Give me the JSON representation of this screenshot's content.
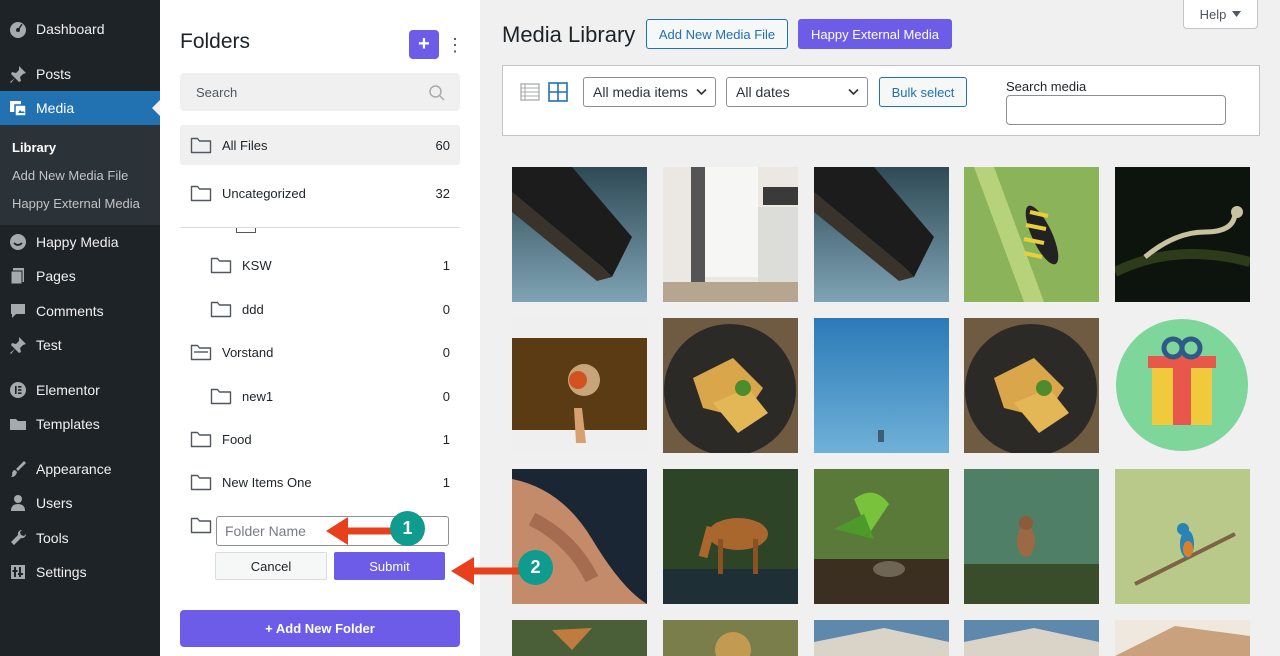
{
  "admin_menu": {
    "items": [
      {
        "label": "Dashboard",
        "icon": "dashboard-icon"
      },
      {
        "label": "Posts",
        "icon": "pin-icon"
      },
      {
        "label": "Media",
        "icon": "media-icon"
      },
      {
        "label": "Happy Media",
        "icon": "happy-media-icon"
      },
      {
        "label": "Pages",
        "icon": "pages-icon"
      },
      {
        "label": "Comments",
        "icon": "comments-icon"
      },
      {
        "label": "Test",
        "icon": "pin-icon"
      },
      {
        "label": "Elementor",
        "icon": "elementor-icon"
      },
      {
        "label": "Templates",
        "icon": "folder-icon"
      },
      {
        "label": "Appearance",
        "icon": "brush-icon"
      },
      {
        "label": "Users",
        "icon": "users-icon"
      },
      {
        "label": "Tools",
        "icon": "wrench-icon"
      },
      {
        "label": "Settings",
        "icon": "settings-icon"
      }
    ],
    "submenu": [
      "Library",
      "Add New Media File",
      "Happy External Media"
    ]
  },
  "folders": {
    "title": "Folders",
    "add_icon": "+",
    "search_placeholder": "Search",
    "all_files": {
      "label": "All Files",
      "count": "60"
    },
    "list": [
      {
        "label": "Uncategorized",
        "count": "32"
      },
      {
        "label": "KSW",
        "count": "1"
      },
      {
        "label": "ddd",
        "count": "0"
      },
      {
        "label": "Vorstand",
        "count": "0"
      },
      {
        "label": "new1",
        "count": "0"
      },
      {
        "label": "Food",
        "count": "1"
      },
      {
        "label": "New Items One",
        "count": "1"
      }
    ],
    "new_folder_placeholder": "Folder Name",
    "cancel_label": "Cancel",
    "submit_label": "Submit",
    "add_new_label": "+ Add New Folder"
  },
  "main": {
    "title": "Media Library",
    "add_new_label": "Add New Media File",
    "external_label": "Happy External Media",
    "help_label": "Help",
    "filter_type": "All media items",
    "filter_date": "All dates",
    "bulk_label": "Bulk select",
    "search_label": "Search media"
  },
  "callouts": {
    "one": "1",
    "two": "2"
  },
  "colors": {
    "accent": "#6c5ce7",
    "wp_blue": "#2271b1",
    "arrow": "#e8401c",
    "badge": "#0f9b8e",
    "sidebar": "#1d2327"
  }
}
